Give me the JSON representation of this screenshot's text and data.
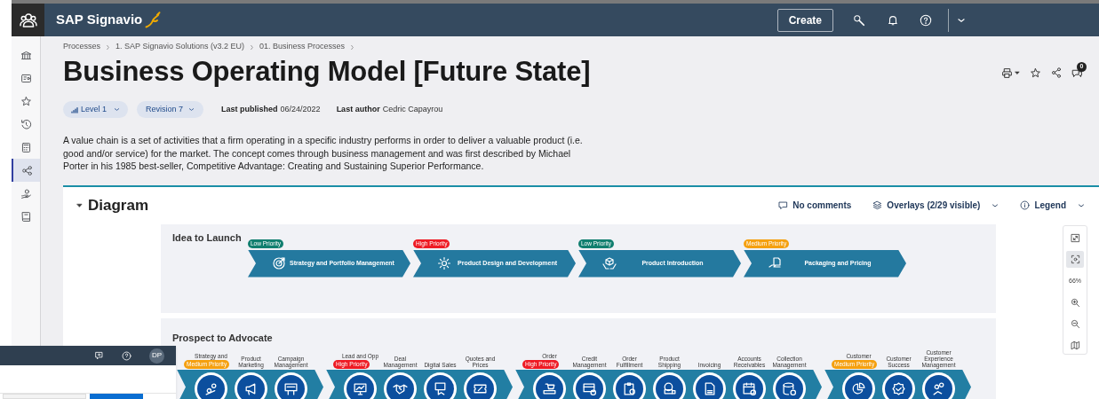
{
  "topbar": {
    "brand": "SAP Signavio",
    "create_button": "Create"
  },
  "sidebar": {
    "items": [
      {
        "selected": false
      },
      {
        "selected": false
      },
      {
        "selected": false
      },
      {
        "selected": false
      },
      {
        "selected": false
      },
      {
        "selected": true
      },
      {
        "selected": false
      },
      {
        "selected": false
      }
    ]
  },
  "breadcrumb": [
    "Processes",
    "1. SAP Signavio Solutions (v3.2 EU)",
    "01. Business Processes"
  ],
  "title": "Business Operating Model [Future State]",
  "comments_badge": "0",
  "meta": {
    "level": "Level 1",
    "revision": "Revision 7",
    "published_label": "Last published",
    "published": "06/24/2022",
    "author_label": "Last author",
    "author": "Cedric Capayrou"
  },
  "description": "A value chain is a set of activities that a firm operating in a specific industry performs in order to deliver a valuable product (i.e. good and/or service) for the market. The concept comes through business management and was first described by Michael Porter in his 1985 best-seller, Competitive Advantage: Creating and Sustaining Superior Performance.",
  "diagram": {
    "heading": "Diagram",
    "expanded": true,
    "comments": "No comments",
    "overlays": "Overlays (2/29 visible)",
    "legend": "Legend",
    "lanes": [
      {
        "title": "Idea to Launch",
        "kind": "chevrons",
        "steps": [
          {
            "label": "Strategy and Portfolio Management",
            "tag": {
              "label": "Low Priority",
              "color": "#117f6f"
            }
          },
          {
            "label": "Product Design and Development",
            "tag": {
              "label": "High Priority",
              "color": "#ee1b24"
            }
          },
          {
            "label": "Product Introduction",
            "tag": {
              "label": "Low Priority",
              "color": "#117f6f"
            }
          },
          {
            "label": "Packaging and Pricing",
            "tag": {
              "label": "Medium Priority",
              "color": "#f5a00f"
            }
          }
        ]
      },
      {
        "title": "Prospect to Advocate",
        "kind": "circles",
        "groups": [
          {
            "tag": {
              "label": "Medium Priority",
              "color": "#f5a00f"
            },
            "items": [
              "Strategy and",
              "Product Marketing",
              "Campaign Management"
            ]
          },
          {
            "tag": {
              "label": "High Priority",
              "color": "#ee1b24"
            },
            "items": [
              "Lead and Opp",
              "Deal Management",
              "Digital Sales",
              "Quotes and Prices"
            ]
          },
          {
            "tag": {
              "label": "High Priority",
              "color": "#ee1b24"
            },
            "items": [
              "Order",
              "Credit Management",
              "Order Fulfillment",
              "Product Shipping",
              "Invoicing",
              "Accounts Receivables",
              "Collection Management"
            ]
          },
          {
            "tag": {
              "label": "Medium Priority",
              "color": "#f5a00f"
            },
            "items": [
              "Customer",
              "Customer Success",
              "Customer Experience Management"
            ]
          }
        ]
      }
    ],
    "zoom_toolbar": {
      "zoom": "66%",
      "fit_selected": true
    }
  },
  "overlay_window": {
    "avatar": "DP"
  }
}
